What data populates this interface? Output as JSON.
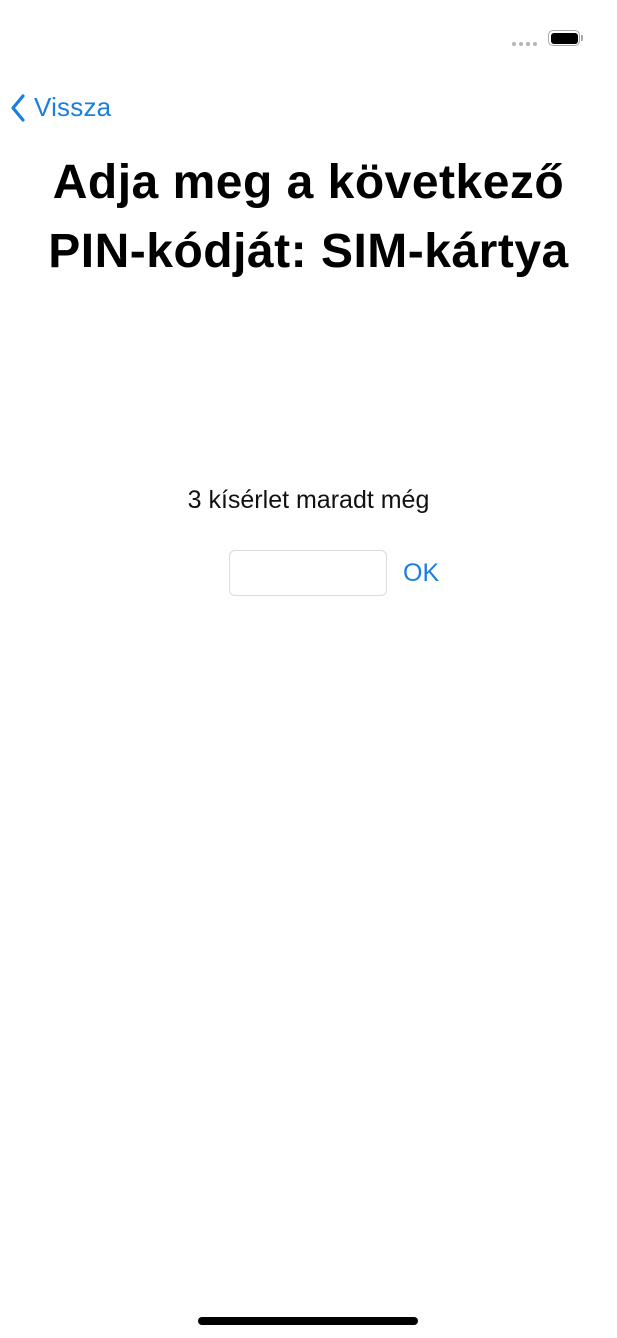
{
  "status_bar": {
    "signal_icon": "signal-dots-icon",
    "battery_icon": "battery-icon"
  },
  "nav": {
    "back_label": "Vissza",
    "back_icon": "chevron-left-icon",
    "accent_color": "#1a7fe0"
  },
  "main": {
    "title": "Adja meg a következő PIN-kódját: SIM-kártya",
    "attempts_text": "3 kísérlet maradt még",
    "pin_input_value": "",
    "ok_label": "OK"
  }
}
